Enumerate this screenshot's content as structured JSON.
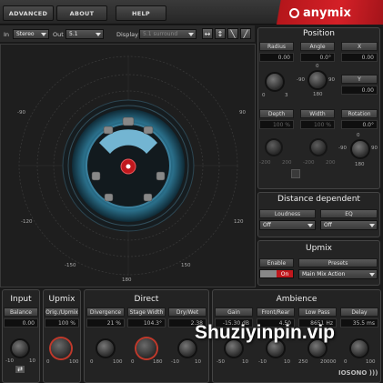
{
  "topbar": {
    "buttons": [
      "ADVANCED",
      "ABOUT",
      "HELP"
    ],
    "logo": "anymix",
    "accent": "#d42027"
  },
  "controls": {
    "in_label": "In",
    "in_value": "Stereo",
    "out_label": "Out",
    "out_value": "5.1",
    "display_label": "Display",
    "display_value": "5.1 surround"
  },
  "scope": {
    "left_labels": [
      "-90",
      "-120",
      "-150"
    ],
    "right_labels": [
      "90",
      "120",
      "150"
    ],
    "bottom_label": "180"
  },
  "position": {
    "title": "Position",
    "radius": {
      "label": "Radius",
      "value": "0.00",
      "min": "0",
      "max": "3"
    },
    "angle": {
      "label": "Angle",
      "value": "0.0°",
      "t": "0",
      "l": "-90",
      "r": "90",
      "b": "180"
    },
    "x": {
      "label": "X",
      "value": "0.00"
    },
    "y": {
      "label": "Y",
      "value": "0.00"
    },
    "depth": {
      "label": "Depth",
      "value": "100 %",
      "min": "-200",
      "max": "200"
    },
    "width": {
      "label": "Width",
      "value": "100 %",
      "min": "-200",
      "max": "200"
    },
    "rotation": {
      "label": "Rotation",
      "value": "0.0°",
      "t": "0",
      "l": "-90",
      "r": "90",
      "b": "180"
    }
  },
  "distance": {
    "title": "Distance dependent",
    "loudness": {
      "label": "Loudness",
      "value": "Off"
    },
    "eq": {
      "label": "EQ",
      "value": "Off"
    }
  },
  "upmix_panel": {
    "title": "Upmix",
    "enable": {
      "label": "Enable",
      "value": "On"
    },
    "presets": {
      "label": "Presets",
      "value": "Main Mix Action"
    }
  },
  "input": {
    "title": "Input",
    "balance": {
      "label": "Balance",
      "value": "0.00",
      "min": "-10",
      "max": "10"
    }
  },
  "upmix": {
    "title": "Upmix",
    "orig": {
      "label": "Orig./Upmix",
      "value": "100 %",
      "min": "0",
      "max": "100"
    }
  },
  "direct": {
    "title": "Direct",
    "divergence": {
      "label": "Divergence",
      "value": "21 %",
      "min": "0",
      "max": "100"
    },
    "stage": {
      "label": "Stage Width",
      "value": "104.3°",
      "min": "0",
      "max": "180"
    },
    "drywet": {
      "label": "Dry/Wet",
      "value": "2.38",
      "min": "-10",
      "max": "10"
    }
  },
  "ambience": {
    "title": "Ambience",
    "gain": {
      "label": "Gain",
      "value": "-15.30 dB",
      "min": "-50",
      "max": "10"
    },
    "frontrear": {
      "label": "Front/Rear",
      "value": "4.50",
      "min": "-10",
      "max": "10"
    },
    "lowpass": {
      "label": "Low Pass",
      "value": "8651 Hz",
      "min": "250",
      "max": "20000"
    },
    "delay": {
      "label": "Delay",
      "value": "35.5 ms",
      "min": "0",
      "max": "100"
    }
  },
  "footer": {
    "brand": "IOSONO )))"
  },
  "watermark": "Shuziyinpin.vip"
}
